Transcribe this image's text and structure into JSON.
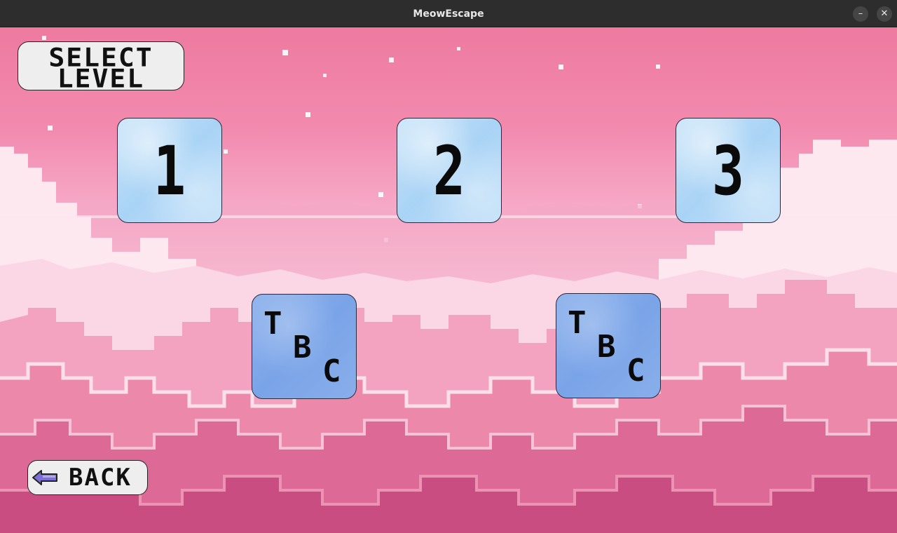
{
  "window": {
    "title": "MeowEscape",
    "minimize_label": "–",
    "close_label": "✕"
  },
  "header": {
    "line1": "SELECT",
    "line2": "LEVEL"
  },
  "levels": [
    {
      "label": "1",
      "state": "unlocked"
    },
    {
      "label": "2",
      "state": "unlocked"
    },
    {
      "label": "3",
      "state": "unlocked"
    }
  ],
  "upcoming": [
    {
      "t": "T",
      "b": "B",
      "c": "C"
    },
    {
      "t": "T",
      "b": "B",
      "c": "C"
    }
  ],
  "back": {
    "label": "BACK",
    "icon": "left-arrow-icon",
    "icon_color": "#7d6fd6"
  },
  "colors": {
    "sky_top": "#ee7aa0",
    "cloud_light": "#fde6ef",
    "tile_light": "#b5d9f6",
    "tile_dark": "#7ea8e9"
  }
}
